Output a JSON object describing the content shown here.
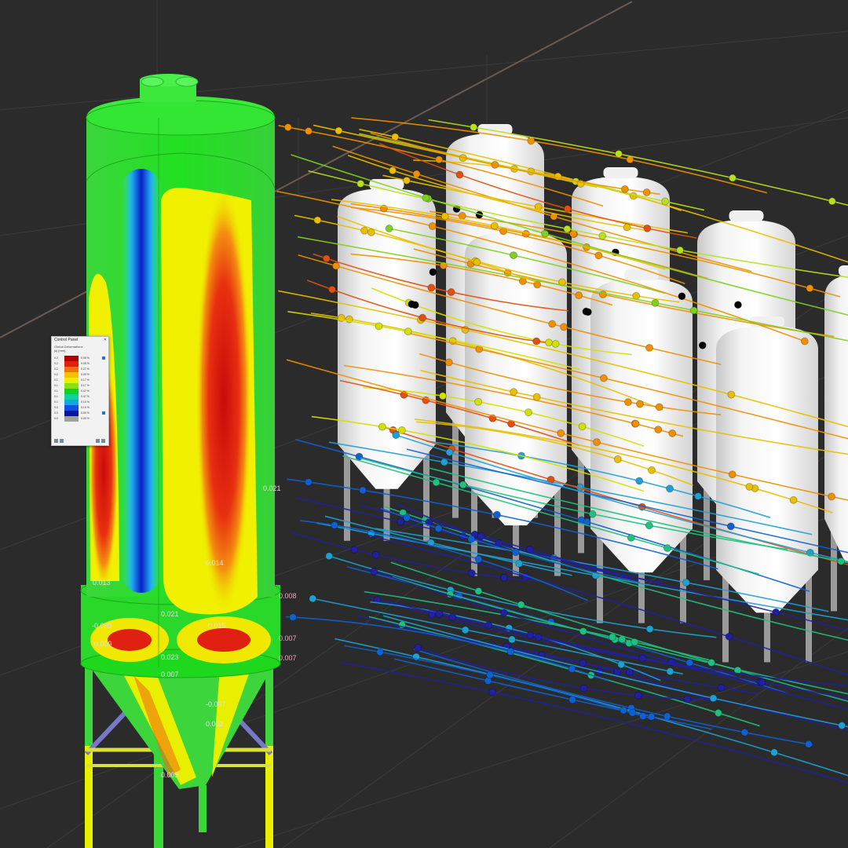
{
  "viewport": {
    "background": "#2b2b2b"
  },
  "control_panel": {
    "title": "Control Panel",
    "close_icon": "close-icon",
    "subtitle": "Global Deformations",
    "unit": "|u| [mm]",
    "legend": [
      {
        "value": "0.2",
        "color": "#b00000",
        "percent": "0.05 %"
      },
      {
        "value": "0.2",
        "color": "#e02010",
        "percent": "0.05 %"
      },
      {
        "value": "0.2",
        "color": "#f07010",
        "percent": "0.27 %"
      },
      {
        "value": "0.2",
        "color": "#f4c000",
        "percent": "0.09 %"
      },
      {
        "value": "0.1",
        "color": "#e8f000",
        "percent": "0.17 %"
      },
      {
        "value": "0.1",
        "color": "#8ce010",
        "percent": "0.17 %"
      },
      {
        "value": "0.1",
        "color": "#10d020",
        "percent": "0.47 %"
      },
      {
        "value": "0.1",
        "color": "#10d0a0",
        "percent": "0.47 %"
      },
      {
        "value": "0.1",
        "color": "#10a8e0",
        "percent": "0.10 %"
      },
      {
        "value": "0.0",
        "color": "#1050e0",
        "percent": "0.10 %"
      },
      {
        "value": "0.0",
        "color": "#1010a0",
        "percent": "0.00 %"
      },
      {
        "value": "0.0",
        "color": "#a0a0a0",
        "percent": "0.00 %"
      }
    ]
  },
  "silo_labels": [
    "0.021",
    "0.014",
    "0.015",
    "0.021",
    "-0.009",
    "0.009",
    "0.023",
    "0.007",
    "-0.007",
    "0.002",
    "0.005",
    "0.013",
    "0.008",
    "0.007",
    "0.007"
  ],
  "icons": {
    "silo": "deformed-silo-model",
    "tanks": "fermentation-tank-icon",
    "streamlines": "wind-streamline-icon"
  }
}
